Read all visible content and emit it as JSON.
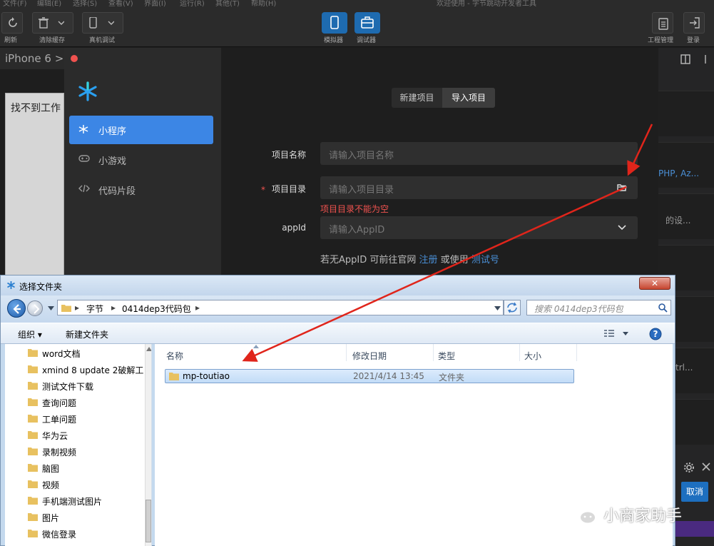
{
  "ide": {
    "menubar": [
      "文件(F)",
      "编辑(E)",
      "选择(S)",
      "查看(V)",
      "界面(I)",
      "运行(R)",
      "其他(T)",
      "帮助(H)"
    ],
    "window_title": "欢迎使用 - 字节跳动开发者工具",
    "toolbar": {
      "refresh": "刷新",
      "clear_cache": "清除缓存",
      "device_debug": "真机调试",
      "simulator": "模拟器",
      "debugger": "调试器",
      "project_manage": "工程管理",
      "login": "登录"
    },
    "device": "iPhone 6 >",
    "sim_text": "找不到工作",
    "right_panel": {
      "php_text": "PHP, Az...",
      "settings_text": "的设...",
      "ctrl_text": "trl...",
      "cancel": "取消"
    }
  },
  "dialog": {
    "nav": [
      {
        "label": "小程序",
        "active": true
      },
      {
        "label": "小游戏",
        "active": false
      },
      {
        "label": "代码片段",
        "active": false
      }
    ],
    "tabs": {
      "new": "新建项目",
      "import": "导入项目"
    },
    "fields": {
      "name_label": "项目名称",
      "name_placeholder": "请输入项目名称",
      "dir_label": "项目目录",
      "dir_required": "*",
      "dir_placeholder": "请输入项目目录",
      "dir_error": "项目目录不能为空",
      "appid_label": "appId",
      "appid_placeholder": "请输入AppID"
    },
    "hint": {
      "prefix": "若无AppID 可前往官网",
      "register": "注册",
      "middle": "或使用",
      "test": "测试号"
    }
  },
  "picker": {
    "title": "选择文件夹",
    "path": [
      "字节",
      "0414dep3代码包"
    ],
    "search_placeholder": "搜索 0414dep3代码包",
    "organize": "组织 ▾",
    "new_folder": "新建文件夹",
    "tree": [
      "word文档",
      "xmind 8 update 2破解工",
      "测试文件下载",
      "查询问题",
      "工单问题",
      "华为云",
      "录制视频",
      "脑图",
      "视频",
      "手机端测试图片",
      "图片",
      "微信登录"
    ],
    "columns": {
      "name": "名称",
      "modified": "修改日期",
      "type": "类型",
      "size": "大小"
    },
    "rows": [
      {
        "name": "mp-toutiao",
        "modified": "2021/4/14 13:45",
        "type": "文件夹",
        "size": ""
      }
    ]
  },
  "watermark": "小商家助手",
  "colors": {
    "accent": "#3c86e5",
    "error": "#f0524f",
    "link": "#4a8fd6",
    "arrow": "#e0251b"
  }
}
